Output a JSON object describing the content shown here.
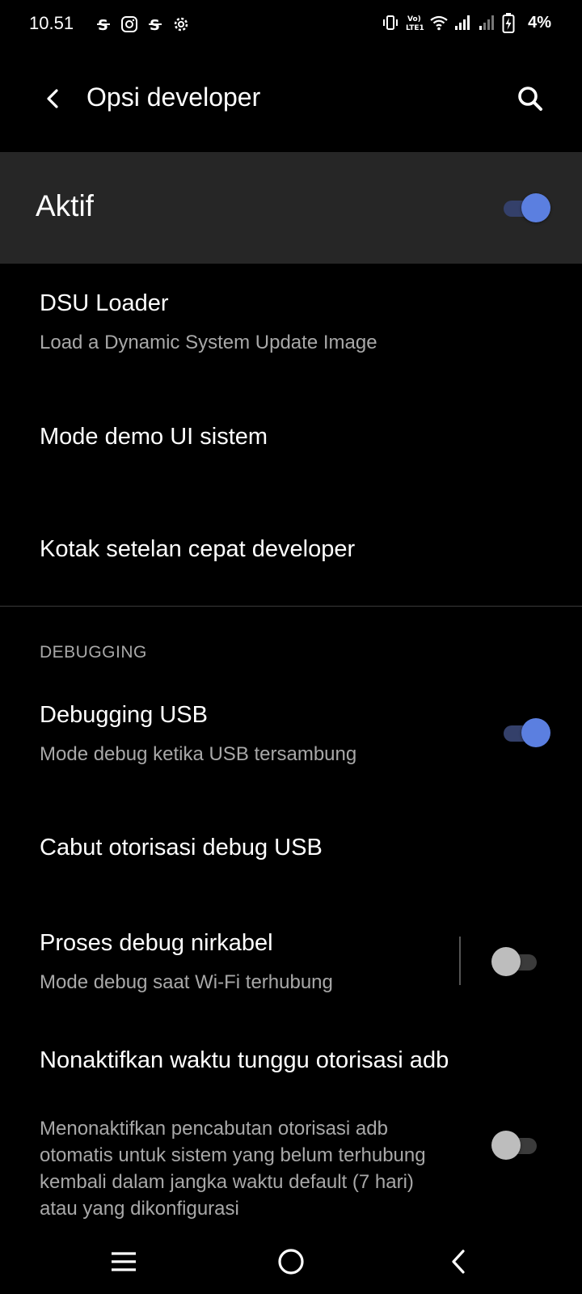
{
  "status_bar": {
    "time": "10.51",
    "left_icons": [
      "s-icon",
      "instagram-icon",
      "s-icon",
      "gear-icon"
    ],
    "right_icons": [
      "vibrate-icon",
      "volte-icon",
      "wifi-icon",
      "signal-icon",
      "signal-weak-icon",
      "battery-charging-icon"
    ],
    "battery_percent": "4%"
  },
  "app_bar": {
    "title": "Opsi developer"
  },
  "master_switch": {
    "label": "Aktif",
    "checked": true
  },
  "items": {
    "dsu_loader": {
      "title": "DSU Loader",
      "summary": "Load a Dynamic System Update Image"
    },
    "demo_mode": {
      "title": "Mode demo UI sistem"
    },
    "quick_tiles": {
      "title": "Kotak setelan cepat developer"
    },
    "usb_debugging": {
      "title": "Debugging USB",
      "summary": "Mode debug ketika USB tersambung",
      "checked": true
    },
    "revoke_usb": {
      "title": "Cabut otorisasi debug USB"
    },
    "wireless_debugging": {
      "title": "Proses debug nirkabel",
      "summary": "Mode debug saat Wi-Fi terhubung",
      "checked": false
    },
    "adb_timeout": {
      "title": "Nonaktifkan waktu tunggu otorisasi adb",
      "summary": "Menonaktifkan pencabutan otorisasi adb otomatis untuk sistem yang belum terhubung kembali dalam jangka waktu default (7 hari) atau yang dikonfigurasi",
      "checked": false
    }
  },
  "section": {
    "debugging_header": "DEBUGGING"
  },
  "colors": {
    "background": "#000000",
    "master_row_bg": "#262626",
    "toggle_on_thumb": "#5b7fe0",
    "toggle_on_track": "#34406a",
    "toggle_off_thumb": "#bdbdbd",
    "summary_text": "#a8a8a8"
  },
  "nav_bar": {
    "icons": [
      "recents-icon",
      "home-icon",
      "back-icon"
    ]
  }
}
